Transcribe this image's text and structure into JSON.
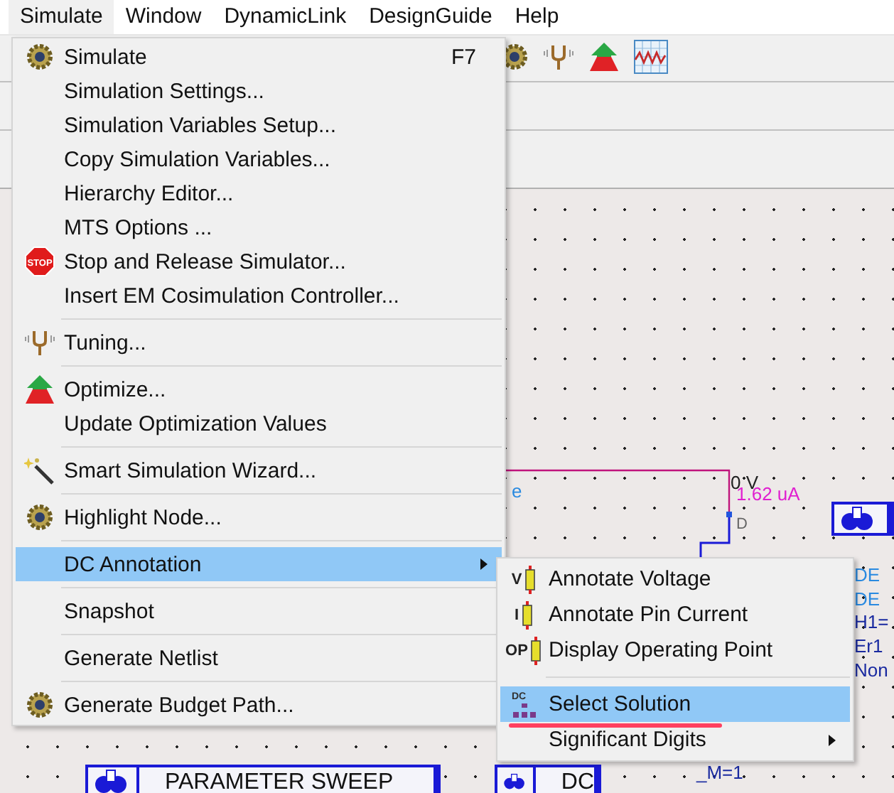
{
  "menubar": [
    {
      "label": "Simulate",
      "selected": true
    },
    {
      "label": "Window",
      "selected": false
    },
    {
      "label": "DynamicLink",
      "selected": false
    },
    {
      "label": "DesignGuide",
      "selected": false
    },
    {
      "label": "Help",
      "selected": false
    }
  ],
  "schematic": {
    "labels": [
      {
        "text": "0 V",
        "kind": "node"
      },
      {
        "text": "1.62 uA",
        "kind": "current"
      },
      {
        "text": "D",
        "kind": "pin"
      },
      {
        "text": "e",
        "kind": "param"
      },
      {
        "text": "DE",
        "kind": "param"
      },
      {
        "text": "DE",
        "kind": "param"
      },
      {
        "text": "H1=",
        "kind": "value"
      },
      {
        "text": "Er1",
        "kind": "value"
      },
      {
        "text": "Non",
        "kind": "value"
      },
      {
        "text": "_M=1",
        "kind": "value"
      }
    ],
    "blocks": [
      {
        "label": "PARAMETER SWEEP"
      },
      {
        "label": "DC"
      }
    ]
  },
  "menu": {
    "groups": [
      [
        {
          "label": "Simulate",
          "shortcut": "F7",
          "submenu": false,
          "selected": false
        },
        {
          "label": "Simulation Settings...",
          "submenu": false,
          "selected": false
        },
        {
          "label": "Simulation Variables Setup...",
          "submenu": false,
          "selected": false
        },
        {
          "label": "Copy Simulation Variables...",
          "submenu": false,
          "selected": false
        },
        {
          "label": "Hierarchy Editor...",
          "submenu": false,
          "selected": false
        },
        {
          "label": "MTS Options ...",
          "submenu": false,
          "selected": false
        },
        {
          "label": "Stop and Release Simulator...",
          "icon_text": "STOP",
          "submenu": false,
          "selected": false
        },
        {
          "label": "Insert EM Cosimulation Controller...",
          "submenu": false,
          "selected": false
        }
      ],
      [
        {
          "label": "Tuning...",
          "submenu": false,
          "selected": false
        }
      ],
      [
        {
          "label": "Optimize...",
          "submenu": false,
          "selected": false
        },
        {
          "label": "Update Optimization Values",
          "submenu": false,
          "selected": false
        }
      ],
      [
        {
          "label": "Smart Simulation Wizard...",
          "submenu": false,
          "selected": false
        }
      ],
      [
        {
          "label": "Highlight Node...",
          "submenu": false,
          "selected": false
        }
      ],
      [
        {
          "label": "DC Annotation",
          "submenu": true,
          "selected": true
        }
      ],
      [
        {
          "label": "Snapshot",
          "submenu": false,
          "selected": false
        }
      ],
      [
        {
          "label": "Generate Netlist",
          "submenu": false,
          "selected": false
        }
      ],
      [
        {
          "label": "Generate Budget Path...",
          "submenu": false,
          "selected": false
        }
      ]
    ]
  },
  "submenu": {
    "groups": [
      [
        {
          "label": "Annotate Voltage",
          "icon_text": "V",
          "submenu": false,
          "selected": false,
          "underlined": false
        },
        {
          "label": "Annotate Pin Current",
          "icon_text": "I",
          "submenu": false,
          "selected": false,
          "underlined": false
        },
        {
          "label": "Display Operating Point",
          "icon_text": "OP",
          "submenu": false,
          "selected": false,
          "underlined": false
        }
      ],
      [
        {
          "label": "Select Solution",
          "icon_text": "DC",
          "submenu": false,
          "selected": true,
          "underlined": true
        },
        {
          "label": "Significant Digits",
          "submenu": true,
          "selected": false,
          "underlined": false
        }
      ]
    ]
  }
}
